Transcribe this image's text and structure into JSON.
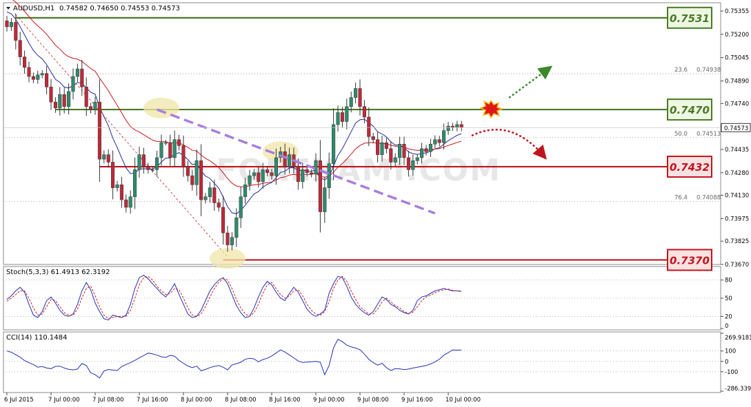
{
  "header": {
    "symbol_label": "AUDUSD,H1",
    "ohlc": "0.74582 0.74650 0.74553 0.74573"
  },
  "watermark": "FOREXAMI.COM",
  "colors": {
    "bull": "#2e8b6e",
    "bear": "#c0283a",
    "support": "#c0141c",
    "resistance": "#4a7a22",
    "ma_fast": "#1e2a9a",
    "ma_slow": "#c8141c",
    "trendline": "#a77ee0",
    "fib": "#8a8a8a",
    "stoch_main": "#1f2fb5",
    "stoch_signal": "#d21a1a",
    "cci": "#1f2fb5",
    "grid": "#a0a0a0"
  },
  "chart_data": [
    {
      "type": "candlestick",
      "title": "AUDUSD,H1",
      "ylim": [
        0.7367,
        0.7541
      ],
      "y_ticks": [
        "0.75355",
        "0.75200",
        "0.75045",
        "0.74890",
        "0.74740",
        "0.74585",
        "0.74435",
        "0.74280",
        "0.74130",
        "0.73975",
        "0.73825",
        "0.73670"
      ],
      "current_price_label": "0.74573",
      "x_ticks": [
        {
          "label": "6 Jul 2015",
          "bar": 0
        },
        {
          "label": "7 Jul 00:00",
          "bar": 10
        },
        {
          "label": "7 Jul 08:00",
          "bar": 20
        },
        {
          "label": "7 Jul 16:00",
          "bar": 30
        },
        {
          "label": "8 Jul 00:00",
          "bar": 40
        },
        {
          "label": "8 Jul 08:00",
          "bar": 50
        },
        {
          "label": "8 Jul 16:00",
          "bar": 60
        },
        {
          "label": "9 Jul 00:00",
          "bar": 70
        },
        {
          "label": "9 Jul 08:00",
          "bar": 80
        },
        {
          "label": "9 Jul 16:00",
          "bar": 90
        },
        {
          "label": "10 Jul 00:00",
          "bar": 100
        }
      ],
      "close": [
        0.7525,
        0.7528,
        0.7516,
        0.7505,
        0.7498,
        0.7492,
        0.749,
        0.7493,
        0.7494,
        0.7485,
        0.7475,
        0.7471,
        0.748,
        0.7472,
        0.7482,
        0.7492,
        0.7497,
        0.7485,
        0.7472,
        0.747,
        0.7475,
        0.7437,
        0.744,
        0.7435,
        0.7418,
        0.742,
        0.741,
        0.7405,
        0.7412,
        0.743,
        0.744,
        0.7432,
        0.743,
        0.743,
        0.7438,
        0.7448,
        0.7448,
        0.7438,
        0.745,
        0.7446,
        0.7432,
        0.7426,
        0.742,
        0.7436,
        0.741,
        0.7412,
        0.7418,
        0.7408,
        0.7405,
        0.7388,
        0.738,
        0.7385,
        0.7398,
        0.7412,
        0.742,
        0.7426,
        0.7428,
        0.7422,
        0.743,
        0.7428,
        0.7426,
        0.7438,
        0.7442,
        0.7432,
        0.744,
        0.7432,
        0.7422,
        0.743,
        0.7428,
        0.7427,
        0.7436,
        0.7402,
        0.7418,
        0.7434,
        0.746,
        0.7468,
        0.7462,
        0.7472,
        0.7478,
        0.7484,
        0.7472,
        0.7465,
        0.7452,
        0.745,
        0.744,
        0.7448,
        0.7444,
        0.7435,
        0.7438,
        0.7447,
        0.7438,
        0.743,
        0.7436,
        0.7438,
        0.7444,
        0.7442,
        0.7447,
        0.745,
        0.7448,
        0.7456,
        0.7459,
        0.7458,
        0.746,
        0.7458
      ],
      "fib_levels": [
        {
          "label": "23.6",
          "value_label": "0.74938",
          "price": 0.74938
        },
        {
          "label": "50.0",
          "value_label": "0.74513",
          "price": 0.74513
        },
        {
          "label": "76.4",
          "value_label": "0.74088",
          "price": 0.74088
        }
      ],
      "horizontal_levels": [
        {
          "label": "0.7531",
          "price": 0.7531,
          "role": "resistance",
          "start_bar": 2
        },
        {
          "label": "0.7470",
          "price": 0.747,
          "role": "resistance",
          "start_bar": 11
        },
        {
          "label": "0.7432",
          "price": 0.7432,
          "role": "support",
          "start_bar": 21
        },
        {
          "label": "0.7370",
          "price": 0.737,
          "role": "support",
          "start_bar": 49
        }
      ],
      "trendline": {
        "from": {
          "bar": 34,
          "price": 0.747
        },
        "to": {
          "bar": 97,
          "price": 0.7401
        }
      },
      "series": [
        {
          "name": "MA fast"
        },
        {
          "name": "MA slow"
        }
      ]
    },
    {
      "type": "line",
      "title": "Stoch(5,3,3) 61.4913 62.3192",
      "ylim": [
        0,
        100
      ],
      "y_ticks": [
        "80",
        "50",
        "20",
        "0"
      ],
      "y_tick_values": [
        80,
        50,
        20,
        0
      ],
      "series": [
        {
          "name": "main",
          "values": [
            48,
            54,
            62,
            68,
            60,
            40,
            22,
            18,
            28,
            46,
            52,
            42,
            30,
            22,
            20,
            24,
            40,
            62,
            76,
            64,
            42,
            28,
            16,
            14,
            22,
            20,
            18,
            22,
            40,
            66,
            84,
            88,
            82,
            74,
            66,
            58,
            52,
            62,
            74,
            56,
            40,
            24,
            18,
            20,
            30,
            46,
            62,
            72,
            80,
            84,
            74,
            56,
            38,
            26,
            18,
            20,
            34,
            52,
            68,
            78,
            72,
            60,
            50,
            46,
            58,
            68,
            60,
            46,
            32,
            24,
            20,
            24,
            30,
            58,
            74,
            86,
            84,
            70,
            52,
            40,
            32,
            26,
            22,
            28,
            40,
            52,
            48,
            40,
            36,
            30,
            26,
            24,
            30,
            46,
            52,
            54,
            58,
            62,
            64,
            66,
            64,
            62,
            62,
            61
          ]
        },
        {
          "name": "signal",
          "values": [
            45,
            50,
            56,
            62,
            62,
            50,
            34,
            22,
            24,
            36,
            48,
            46,
            36,
            26,
            22,
            22,
            32,
            50,
            66,
            70,
            54,
            36,
            22,
            16,
            18,
            20,
            20,
            20,
            30,
            50,
            72,
            84,
            86,
            80,
            70,
            62,
            56,
            58,
            66,
            64,
            50,
            34,
            22,
            20,
            24,
            36,
            52,
            66,
            76,
            82,
            80,
            66,
            48,
            34,
            24,
            20,
            26,
            40,
            58,
            72,
            76,
            66,
            56,
            50,
            54,
            62,
            64,
            54,
            40,
            30,
            24,
            22,
            28,
            44,
            66,
            80,
            86,
            78,
            62,
            48,
            36,
            30,
            24,
            24,
            32,
            44,
            50,
            44,
            38,
            34,
            28,
            25,
            27,
            36,
            46,
            52,
            55,
            59,
            62,
            64,
            65,
            63,
            62,
            62
          ]
        }
      ]
    },
    {
      "type": "line",
      "title": "CCI(14) 110.1484",
      "ylim": [
        -286.3392,
        269.9181
      ],
      "y_ticks": [
        "269.9181",
        "100",
        "0",
        "-100",
        "-286.3392"
      ],
      "y_tick_values": [
        269.9181,
        100,
        0,
        -100,
        -286.3392
      ],
      "series": [
        {
          "name": "CCI(14)",
          "values": [
            100,
            88,
            64,
            40,
            8,
            -12,
            -30,
            -56,
            -50,
            -64,
            -70,
            -48,
            -46,
            -64,
            -76,
            -82,
            -74,
            -20,
            -40,
            -110,
            -128,
            -160,
            -92,
            -78,
            -84,
            -88,
            -50,
            -30,
            -12,
            10,
            34,
            56,
            80,
            72,
            60,
            44,
            38,
            58,
            50,
            10,
            -18,
            -44,
            -60,
            -46,
            -90,
            -78,
            -60,
            -48,
            -40,
            -56,
            -82,
            -34,
            -22,
            -8,
            20,
            30,
            24,
            -4,
            18,
            30,
            52,
            80,
            110,
            90,
            62,
            34,
            4,
            -10,
            -6,
            -4,
            0,
            -8,
            -128,
            -40,
            130,
            212,
            190,
            156,
            140,
            128,
            112,
            70,
            20,
            -12,
            -36,
            -18,
            -60,
            -88,
            -70,
            -72,
            -80,
            -74,
            -64,
            -56,
            -48,
            -40,
            -24,
            -4,
            20,
            60,
            84,
            110,
            108,
            110
          ]
        }
      ]
    }
  ]
}
